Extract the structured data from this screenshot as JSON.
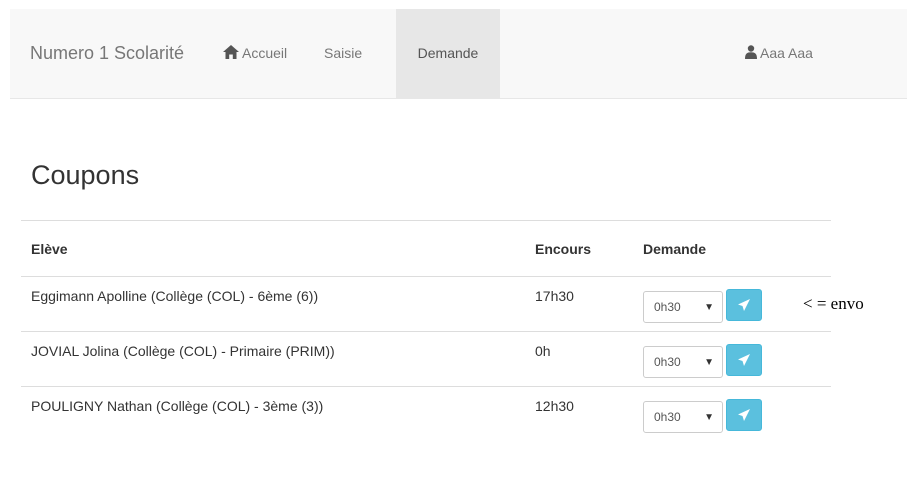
{
  "navbar": {
    "brand": "Numero 1 Scolarité",
    "items": [
      {
        "label": "Accueil",
        "icon": "home-icon"
      },
      {
        "label": "Saisie"
      },
      {
        "label": "Demande",
        "active": true
      }
    ],
    "user": {
      "label": "Aaa Aaa",
      "icon": "user-icon"
    }
  },
  "page": {
    "title": "Coupons"
  },
  "table": {
    "headers": [
      "Elève",
      "Encours",
      "Demande"
    ],
    "rows": [
      {
        "eleve": "Eggimann Apolline (Collège (COL) - 6ème (6))",
        "encours": "17h30",
        "demande": "0h30"
      },
      {
        "eleve": "JOVIAL Jolina (Collège (COL) - Primaire (PRIM))",
        "encours": "0h",
        "demande": "0h30"
      },
      {
        "eleve": "POULIGNY Nathan (Collège (COL) - 3ème (3))",
        "encours": "12h30",
        "demande": "0h30"
      }
    ],
    "send_icon": "send-icon"
  },
  "note": "< = envo",
  "colors": {
    "navbar_bg": "#f8f8f8",
    "active_tab": "#e7e7e7",
    "send_button": "#5bc0de"
  }
}
